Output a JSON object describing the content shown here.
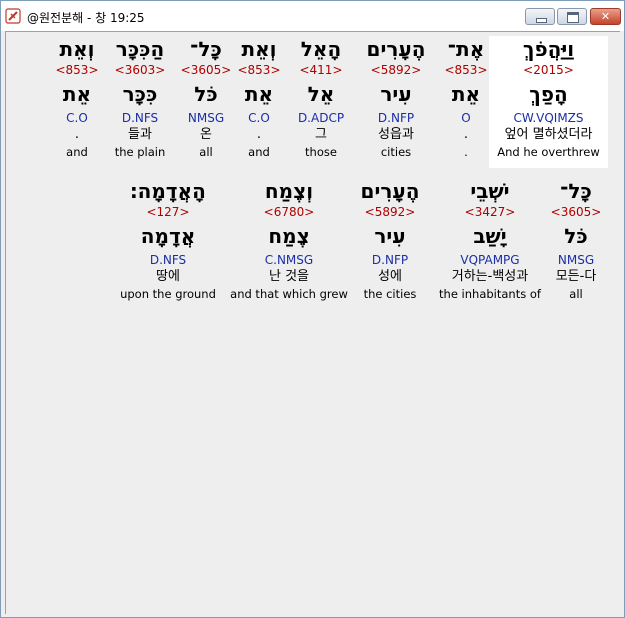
{
  "window": {
    "title": "@원전분해 - 창 19:25",
    "controls": {
      "minimize": "minimize",
      "maximize": "maximize",
      "close": "✕"
    },
    "icon": "bible-cross-icon"
  },
  "verses": [
    [
      {
        "hebrew": "וַיַּהֲפֹךְ",
        "strong": "<2015>",
        "lemma": "הָפַךְ",
        "parse": "CW.VQIMZS",
        "korean": "엎어 멸하셨더라",
        "english": "And he overthrew",
        "selected": true
      },
      {
        "hebrew": "אֶת־",
        "strong": "<853>",
        "lemma": "אֵת",
        "parse": "O",
        "korean": ".",
        "english": "."
      },
      {
        "hebrew": "הֶעָרִים",
        "strong": "<5892>",
        "lemma": "עִיר",
        "parse": "D.NFP",
        "korean": "성읍과",
        "english": "cities"
      },
      {
        "hebrew": "הָאֵל",
        "strong": "<411>",
        "lemma": "אֵל",
        "parse": "D.ADCP",
        "korean": "그",
        "english": "those"
      },
      {
        "hebrew": "וְאֵת",
        "strong": "<853>",
        "lemma": "אֵת",
        "parse": "C.O",
        "korean": ".",
        "english": "and"
      },
      {
        "hebrew": "כָּל־",
        "strong": "<3605>",
        "lemma": "כֹּל",
        "parse": "NMSG",
        "korean": "온",
        "english": "all"
      },
      {
        "hebrew": "הַכִּכָּר",
        "strong": "<3603>",
        "lemma": "כִּכָּר",
        "parse": "D.NFS",
        "korean": "들과",
        "english": "the plain"
      },
      {
        "hebrew": "וְאֵת",
        "strong": "<853>",
        "lemma": "אֵת",
        "parse": "C.O",
        "korean": ".",
        "english": "and"
      }
    ],
    [
      {
        "hebrew": "כָּל־",
        "strong": "<3605>",
        "lemma": "כֹּל",
        "parse": "NMSG",
        "korean": "모든-다",
        "english": "all"
      },
      {
        "hebrew": "יֹשְׁבֵי",
        "strong": "<3427>",
        "lemma": "יָשַׁב",
        "parse": "VQPAMPG",
        "korean": "거하는-백성과",
        "english": "the inhabitants of"
      },
      {
        "hebrew": "הֶעָרִים",
        "strong": "<5892>",
        "lemma": "עִיר",
        "parse": "D.NFP",
        "korean": "성에",
        "english": "the cities"
      },
      {
        "hebrew": "וְצֶמַח",
        "strong": "<6780>",
        "lemma": "צֶמַח",
        "parse": "C.NMSG",
        "korean": "난 것을",
        "english": "and that which grew"
      },
      {
        "hebrew": "הָאֲדָמָה׃",
        "strong": "<127>",
        "lemma": "אֲדָמָה",
        "parse": "D.NFS",
        "korean": "땅에",
        "english": "upon the ground"
      }
    ]
  ]
}
